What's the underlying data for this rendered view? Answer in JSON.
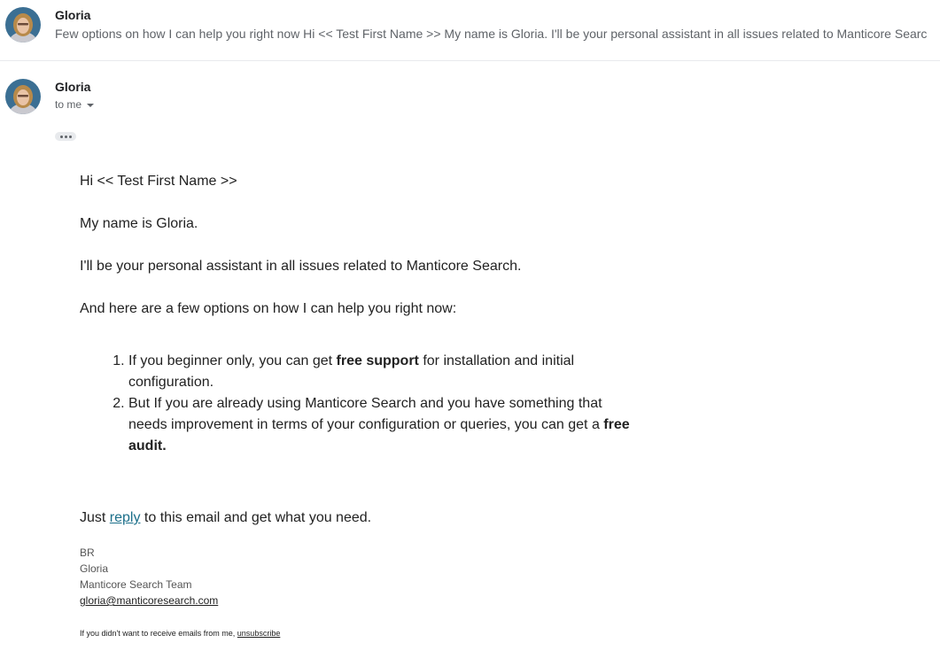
{
  "collapsed_message": {
    "sender": "Gloria",
    "snippet": "Few options on how I can help you right now Hi << Test First Name >> My name is Gloria. I'll be your personal assistant in all issues related to Manticore Searc"
  },
  "open_message": {
    "sender": "Gloria",
    "recipient": "to me",
    "greeting": "Hi << Test First Name >>",
    "intro": "My name is Gloria.",
    "assistant_line": "I'll be your personal assistant in all issues related to Manticore Search.",
    "options_intro": "And here are a few options on how I can help you right now:",
    "options": [
      {
        "before": "If you beginner only, you can get ",
        "bold": "free support",
        "after": " for installation and initial configuration."
      },
      {
        "before": "But If you are already using Manticore Search and you have something that needs improvement in terms of your configuration or queries, you can get a ",
        "bold": "free audit.",
        "after": ""
      }
    ],
    "cta_before": "Just ",
    "cta_link": "reply",
    "cta_after": " to this email and get what you need.",
    "signature": {
      "line1": "BR",
      "line2": "Gloria",
      "line3": "Manticore Search Team",
      "email": "gloria@manticoresearch.com"
    },
    "footer_text": "If you didn't want to receive emails from me, ",
    "footer_link": "unsubscribe"
  },
  "colors": {
    "link": "#1b6f8a",
    "muted": "#5f6368",
    "text": "#222222"
  }
}
